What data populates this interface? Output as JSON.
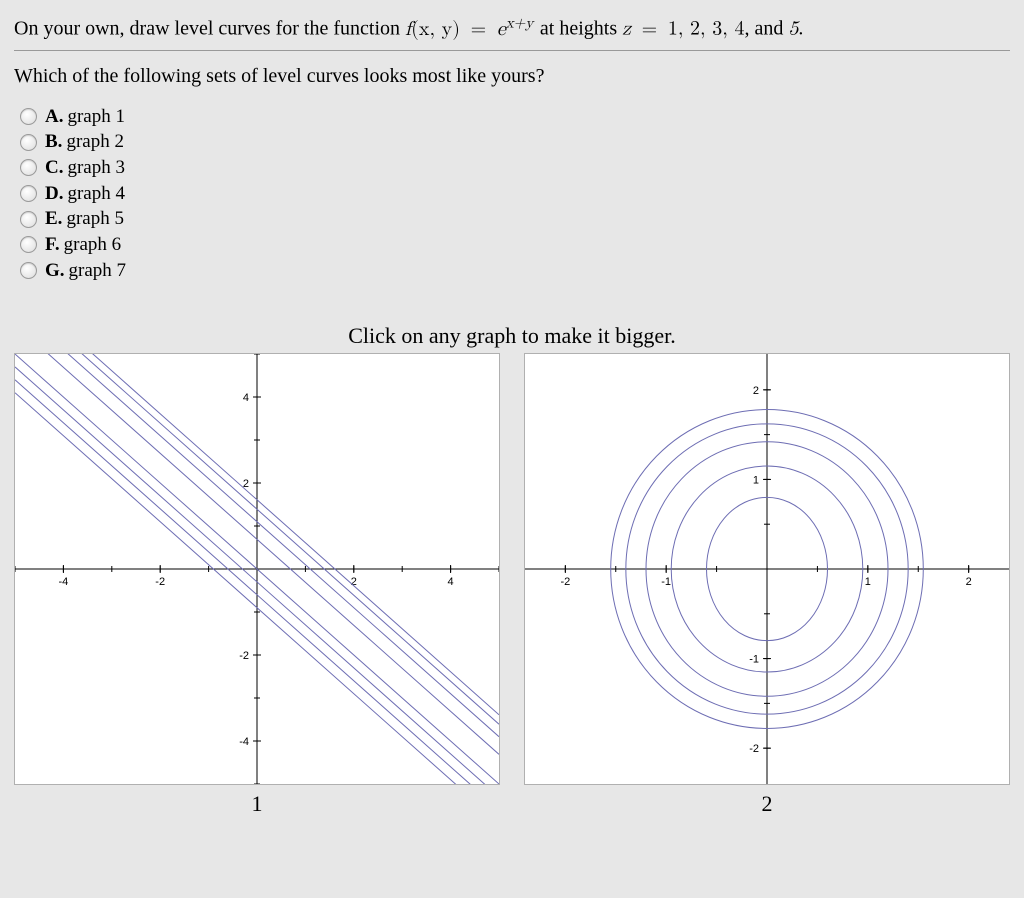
{
  "question": {
    "intro": "On your own, draw level curves for the function ",
    "between": " at heights ",
    "tail": ", and ",
    "finalDot": "."
  },
  "formula": {
    "fn": "f",
    "args": "(x, y)",
    "equals": "=",
    "base": "e",
    "exp": "x+y"
  },
  "heights": {
    "zvar": "z",
    "eq": "=",
    "list": "1, 2, 3, 4",
    "last": "5"
  },
  "subquestion": "Which of the following sets of level curves looks most like yours?",
  "options": [
    {
      "letter": "A.",
      "text": "graph 1"
    },
    {
      "letter": "B.",
      "text": "graph 2"
    },
    {
      "letter": "C.",
      "text": "graph 3"
    },
    {
      "letter": "D.",
      "text": "graph 4"
    },
    {
      "letter": "E.",
      "text": "graph 5"
    },
    {
      "letter": "F.",
      "text": "graph 6"
    },
    {
      "letter": "G.",
      "text": "graph 7"
    }
  ],
  "hint": "Click on any graph to make it bigger.",
  "chart_data": [
    {
      "type": "line",
      "title": "1",
      "description": "Level curves of e^{x+y}: family of parallel lines y = -x + c with slope -1, clustered near the origin and spreading for larger c",
      "xlim": [
        -5,
        5
      ],
      "ylim": [
        -5,
        5
      ],
      "xticks": [
        -4,
        -2,
        2,
        4
      ],
      "yticks": [
        -4,
        -2,
        2,
        4
      ],
      "series": [
        {
          "name": "z=1",
          "c": 0.0
        },
        {
          "name": "z=2",
          "c": 0.69
        },
        {
          "name": "z=3",
          "c": 1.1
        },
        {
          "name": "z=4",
          "c": 1.39
        },
        {
          "name": "z=5",
          "c": 1.61
        },
        {
          "name": "extra1",
          "c": -0.3
        },
        {
          "name": "extra2",
          "c": -0.6
        },
        {
          "name": "extra3",
          "c": -0.9
        }
      ]
    },
    {
      "type": "line",
      "title": "2",
      "description": "Concentric ellipses centered at origin",
      "xlim": [
        -2.4,
        2.4
      ],
      "ylim": [
        -2.4,
        2.4
      ],
      "xticks": [
        -2,
        -1,
        1,
        2
      ],
      "yticks": [
        -2,
        -1,
        1,
        2
      ],
      "series": [
        {
          "name": "r1",
          "rx": 0.6,
          "ry": 0.8
        },
        {
          "name": "r2",
          "rx": 0.95,
          "ry": 1.15
        },
        {
          "name": "r3",
          "rx": 1.2,
          "ry": 1.42
        },
        {
          "name": "r4",
          "rx": 1.4,
          "ry": 1.62
        },
        {
          "name": "r5",
          "rx": 1.55,
          "ry": 1.78
        }
      ]
    }
  ],
  "graph_labels": {
    "g1": "1",
    "g2": "2"
  }
}
